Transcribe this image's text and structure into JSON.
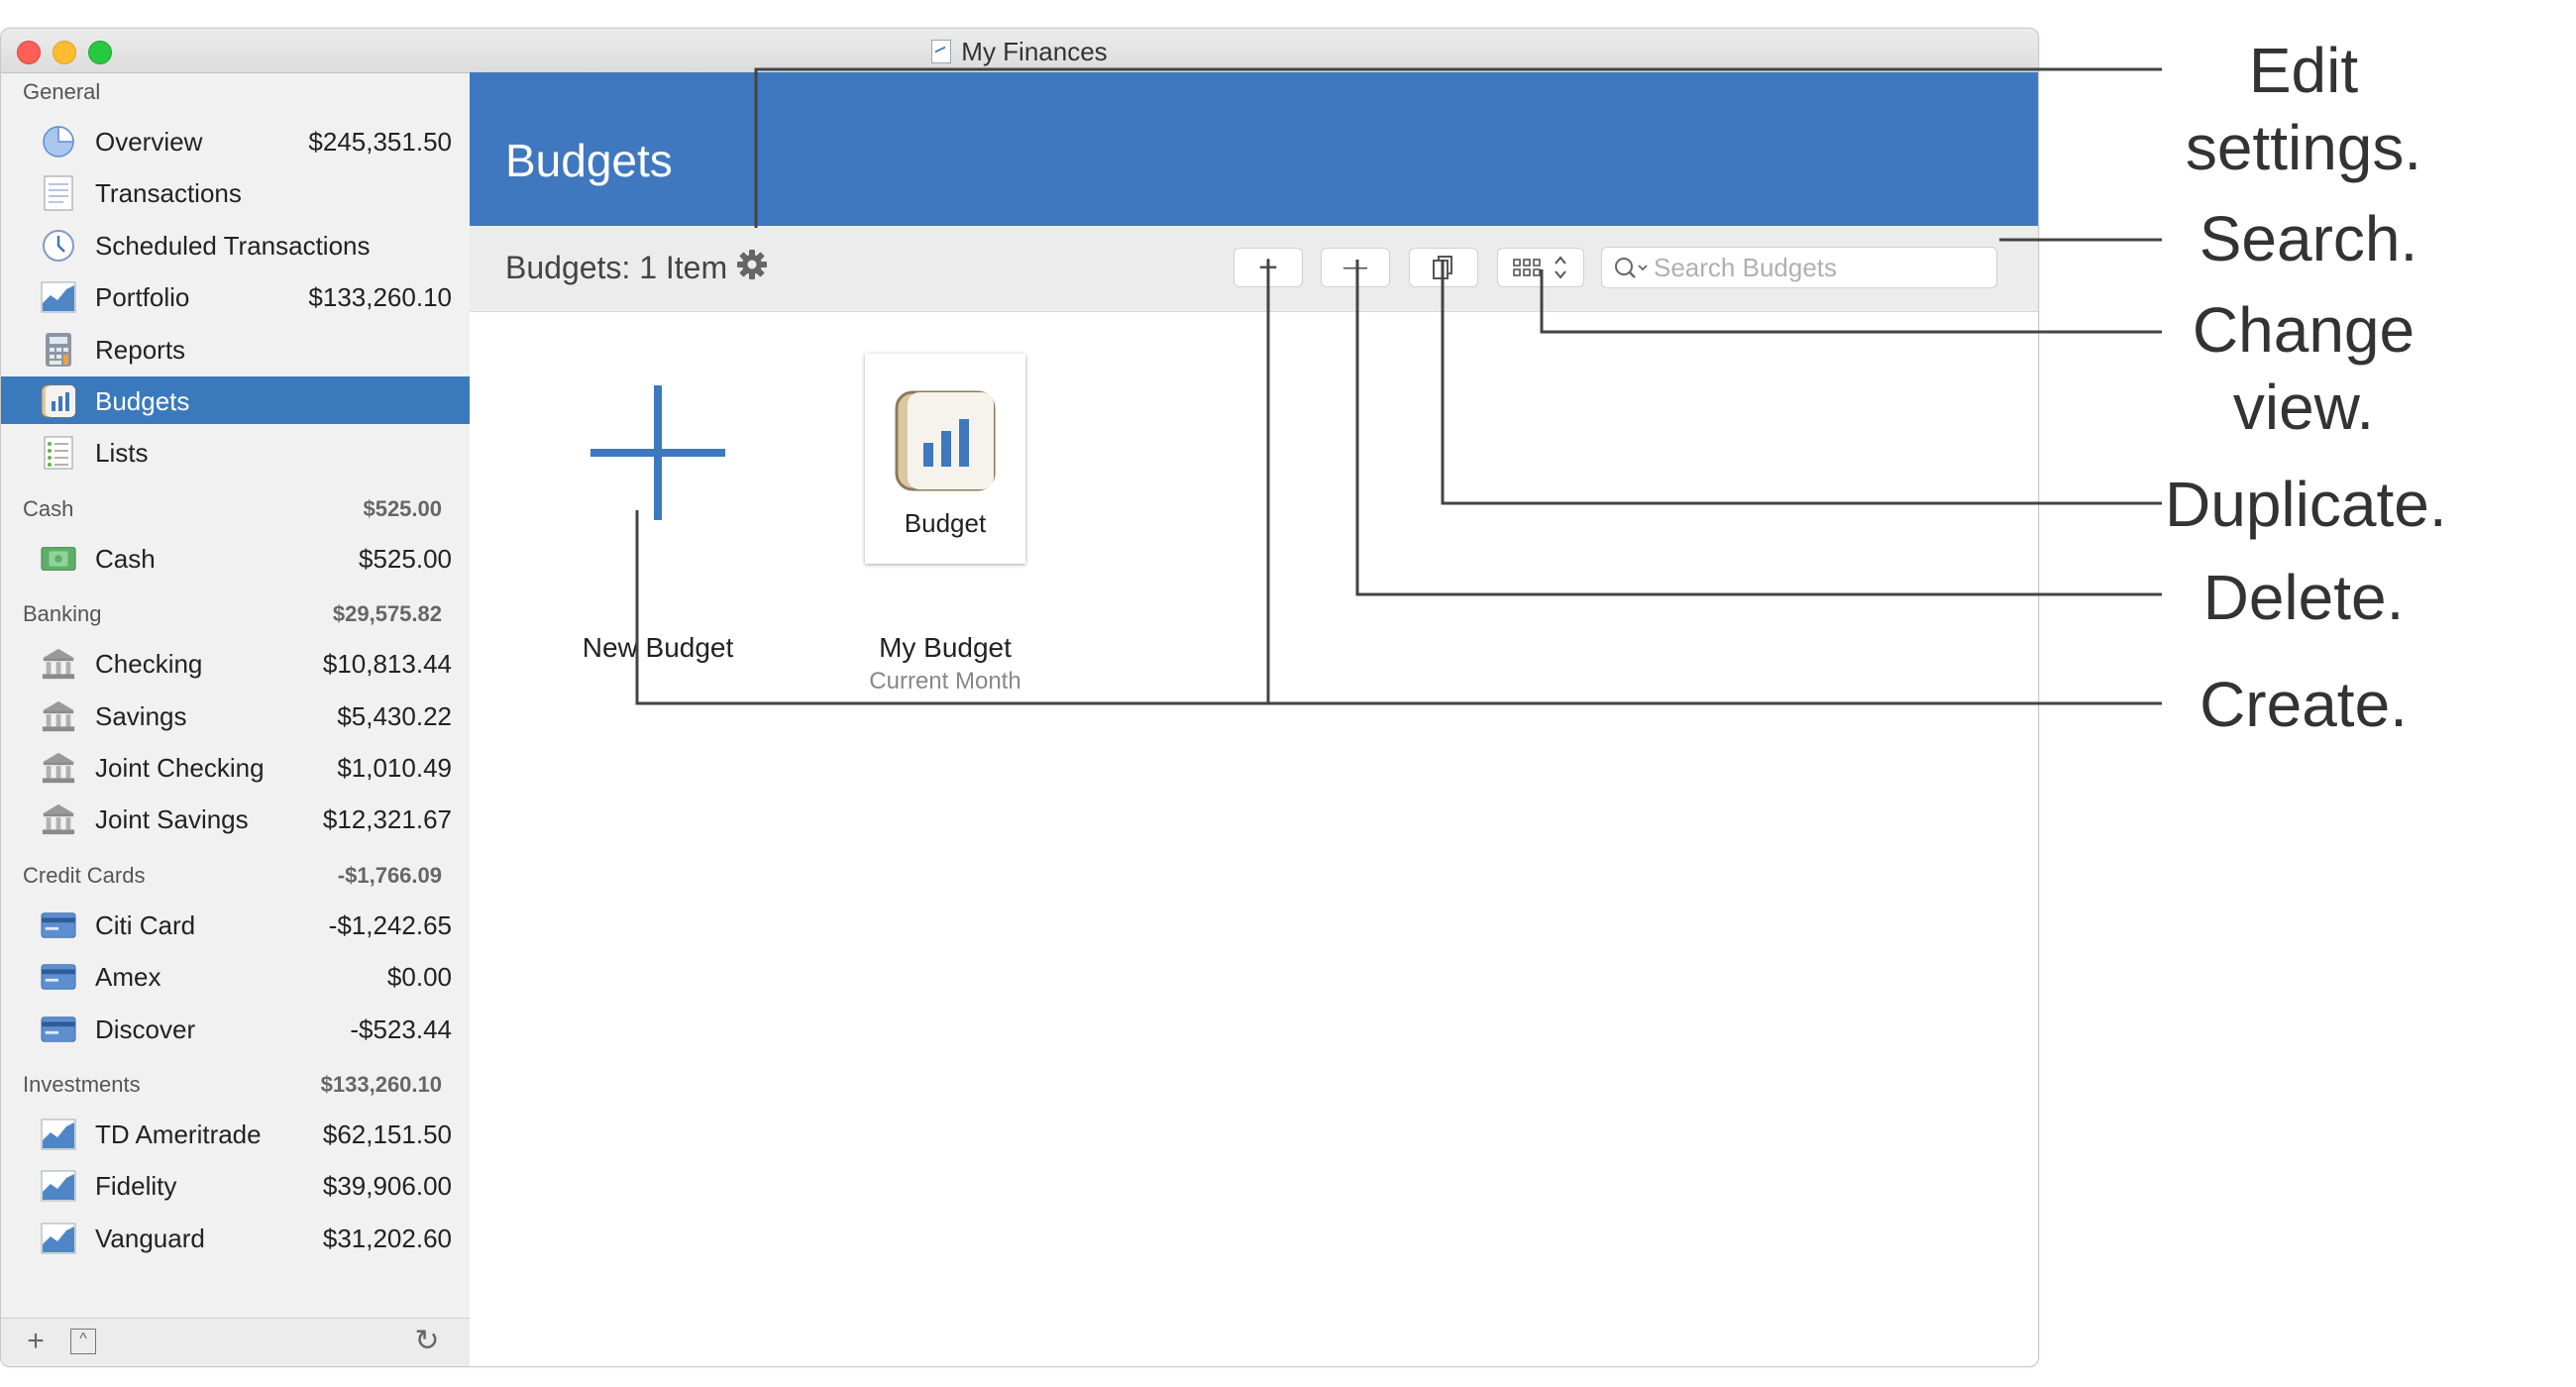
{
  "window": {
    "title": "My Finances"
  },
  "sidebar": {
    "sections": [
      {
        "heading": "General",
        "total": "",
        "items": [
          {
            "label": "Overview",
            "value": "$245,351.50",
            "icon": "pie-chart-icon"
          },
          {
            "label": "Transactions",
            "value": "",
            "icon": "ledger-icon"
          },
          {
            "label": "Scheduled Transactions",
            "value": "",
            "icon": "clock-icon"
          },
          {
            "label": "Portfolio",
            "value": "$133,260.10",
            "icon": "area-chart-icon"
          },
          {
            "label": "Reports",
            "value": "",
            "icon": "calculator-icon"
          },
          {
            "label": "Budgets",
            "value": "",
            "icon": "budget-icon",
            "selected": true
          },
          {
            "label": "Lists",
            "value": "",
            "icon": "list-icon"
          }
        ]
      },
      {
        "heading": "Cash",
        "total": "$525.00",
        "items": [
          {
            "label": "Cash",
            "value": "$525.00",
            "icon": "cash-icon"
          }
        ]
      },
      {
        "heading": "Banking",
        "total": "$29,575.82",
        "items": [
          {
            "label": "Checking",
            "value": "$10,813.44",
            "icon": "bank-icon"
          },
          {
            "label": "Savings",
            "value": "$5,430.22",
            "icon": "bank-icon"
          },
          {
            "label": "Joint Checking",
            "value": "$1,010.49",
            "icon": "bank-icon"
          },
          {
            "label": "Joint Savings",
            "value": "$12,321.67",
            "icon": "bank-icon"
          }
        ]
      },
      {
        "heading": "Credit Cards",
        "total": "-$1,766.09",
        "items": [
          {
            "label": "Citi Card",
            "value": "-$1,242.65",
            "icon": "credit-card-icon"
          },
          {
            "label": "Amex",
            "value": "$0.00",
            "icon": "credit-card-icon"
          },
          {
            "label": "Discover",
            "value": "-$523.44",
            "icon": "credit-card-icon"
          }
        ]
      },
      {
        "heading": "Investments",
        "total": "$133,260.10",
        "items": [
          {
            "label": "TD Ameritrade",
            "value": "$62,151.50",
            "icon": "area-chart-icon"
          },
          {
            "label": "Fidelity",
            "value": "$39,906.00",
            "icon": "area-chart-icon"
          },
          {
            "label": "Vanguard",
            "value": "$31,202.60",
            "icon": "area-chart-icon"
          }
        ]
      }
    ],
    "footer": {
      "add": "+",
      "refresh": "↻"
    }
  },
  "header": {
    "title": "Budgets"
  },
  "toolbar": {
    "count_label": "Budgets: 1 Item",
    "create": "+",
    "delete": "—",
    "search_placeholder": "Search Budgets"
  },
  "content": {
    "new_tile": {
      "caption": "New Budget"
    },
    "budget_tile": {
      "card_label": "Budget",
      "caption": "My Budget",
      "subtitle": "Current Month"
    }
  },
  "callouts": {
    "edit_settings": "Edit settings.",
    "search": "Search.",
    "change_view": "Change view.",
    "duplicate": "Duplicate.",
    "delete": "Delete.",
    "create": "Create."
  },
  "colors": {
    "accent": "#3f78be",
    "selection": "#3b79bd",
    "sidebar_bg": "#f1f1f1",
    "toolbar_bg": "#ececec"
  }
}
